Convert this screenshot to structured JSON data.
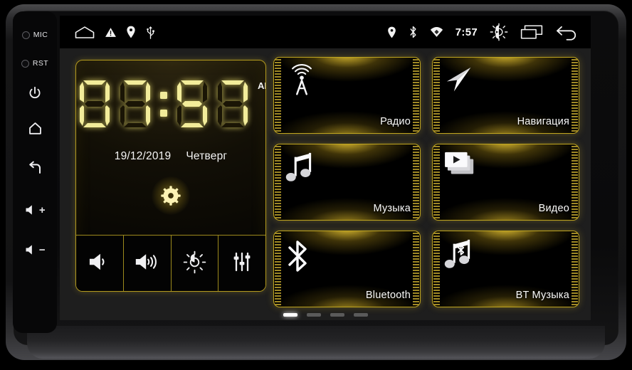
{
  "device": {
    "side_keys": [
      {
        "name": "mic",
        "label": "MIC",
        "has_hole": true
      },
      {
        "name": "reset",
        "label": "RST",
        "has_hole": true
      },
      {
        "name": "power",
        "label": "",
        "icon": "power-icon"
      },
      {
        "name": "home",
        "label": "",
        "icon": "home-icon"
      },
      {
        "name": "back",
        "label": "",
        "icon": "back-arrow-icon"
      },
      {
        "name": "volume-up",
        "label": "+",
        "icon": "speaker-icon"
      },
      {
        "name": "volume-down",
        "label": "−",
        "icon": "speaker-icon"
      }
    ]
  },
  "statusbar": {
    "left_icons": [
      "home-pentagon-icon",
      "warning-triangle-icon",
      "location-pin-icon",
      "usb-icon"
    ],
    "right_icons": [
      "location-pin-icon",
      "bluetooth-icon",
      "wifi-icon"
    ],
    "time": "7:57",
    "trailing_icons": [
      "brightness-icon",
      "recents-icon",
      "back-arrow-icon"
    ]
  },
  "clock_widget": {
    "time_digits": [
      "0",
      "7",
      ":",
      "5",
      "7"
    ],
    "meridiem": "AM",
    "date": "19/12/2019",
    "weekday": "Четверг",
    "settings_icon": "gear-icon",
    "quick_buttons": [
      {
        "name": "volume-down-button",
        "icon": "speaker-low-icon"
      },
      {
        "name": "volume-up-button",
        "icon": "speaker-high-icon"
      },
      {
        "name": "brightness-button",
        "icon": "brightness-sun-icon"
      },
      {
        "name": "equalizer-button",
        "icon": "equalizer-sliders-icon"
      }
    ]
  },
  "tiles": [
    {
      "id": "radio",
      "label": "Радио",
      "icon": "radio-tower-icon"
    },
    {
      "id": "navigation",
      "label": "Навигация",
      "icon": "navigation-arrow-icon"
    },
    {
      "id": "music",
      "label": "Музыка",
      "icon": "music-note-icon"
    },
    {
      "id": "video",
      "label": "Видео",
      "icon": "video-play-icon"
    },
    {
      "id": "bluetooth",
      "label": "Bluetooth",
      "icon": "bluetooth-icon"
    },
    {
      "id": "bt-music",
      "label": "BT Музыка",
      "icon": "bluetooth-music-icon"
    }
  ],
  "pager": {
    "count": 4,
    "active_index": 0
  },
  "colors": {
    "accent": "#e8c832",
    "border": "#c0a520",
    "screen_bg": "#1e1e1e",
    "statusbar_bg": "#000000",
    "text": "#fafafa"
  }
}
